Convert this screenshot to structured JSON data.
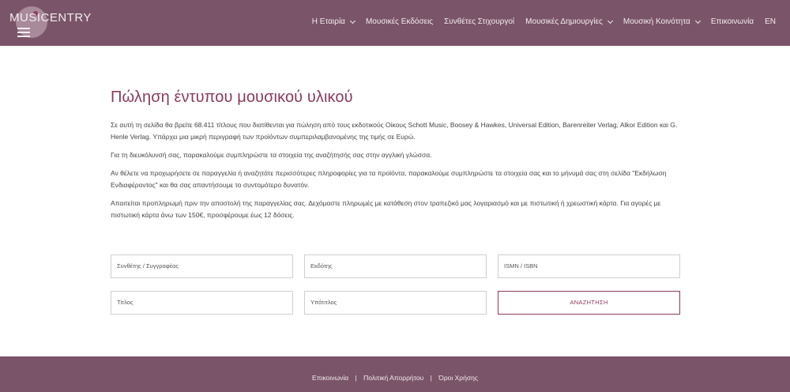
{
  "header": {
    "logo_text": "MUSICENTRY",
    "nav": [
      {
        "label": "Η Εταιρία",
        "has_dropdown": true
      },
      {
        "label": "Μουσικές Εκδόσεις",
        "has_dropdown": false
      },
      {
        "label": "Συνθέτες Στιχουργοί",
        "has_dropdown": false
      },
      {
        "label": "Μουσικές Δημιουργίες",
        "has_dropdown": true
      },
      {
        "label": "Μουσική Κοινότητα",
        "has_dropdown": true
      },
      {
        "label": "Επικοινωνία",
        "has_dropdown": false
      },
      {
        "label": "EN",
        "has_dropdown": false
      }
    ]
  },
  "main": {
    "title": "Πώληση έντυπου μουσικού υλικού",
    "paragraphs": [
      "Σε αυτή τη σελίδα θα βρείτε 68.411 τίτλους που διατίθενται για πώληση από τους εκδοτικούς Οίκους Schott Music, Boosey & Hawkes, Universal Edition, Barenreiter Verlag, Alkor Edition και G. Henle Verlag. Υπάρχει μια μικρή περιγραφή των προϊόντων συμπεριλαμβανομένης της τιμής σε Ευρώ.",
      "Για τη διευκόλυνσή σας, παρακαλούμε συμπληρώστε τα στοιχεία της αναζήτησής σας στην αγγλική γλώσσα.",
      "Αν θέλετε να προχωρήσετε σε παραγγελία ή αναζητάτε περισσότερες πληροφορίες για τα προϊόντα, παρακαλούμε συμπληρώστε τα στοιχεία σας και το μήνυμά σας στη σελίδα \"Εκδήλωση Ενδιαφέροντος\" και θα σας απαντήσουμε το συντομότερο δυνατόν.",
      "Απαιτείται προπληρωμή πριν την αποστολή της παραγγελίας σας. Δεχόμαστε πληρωμές με κατάθεση στον τραπεζικό μας λογαριασμό και με πιστωτική ή χρεωστική κάρτα. Για αγορές με πιστωτική κάρτα άνω των 150€, προσφέρουμε έως 12 δόσεις."
    ]
  },
  "form": {
    "composer_placeholder": "Συνθέτης / Συγγραφέας",
    "publisher_placeholder": "Εκδότης",
    "ismn_placeholder": "ISMN / ISBN",
    "title_placeholder": "Τίτλος",
    "subtitle_placeholder": "Υπότιτλος",
    "search_label": "ΑΝΑΖΗΤΗΣΗ"
  },
  "footer": {
    "links": [
      "Επικοινωνία",
      "Πολιτική Απορρήτου",
      "Όροι Χρήσης"
    ],
    "separator": "|"
  },
  "colors": {
    "brand": "#7a5468",
    "accent": "#8a3a5e"
  }
}
